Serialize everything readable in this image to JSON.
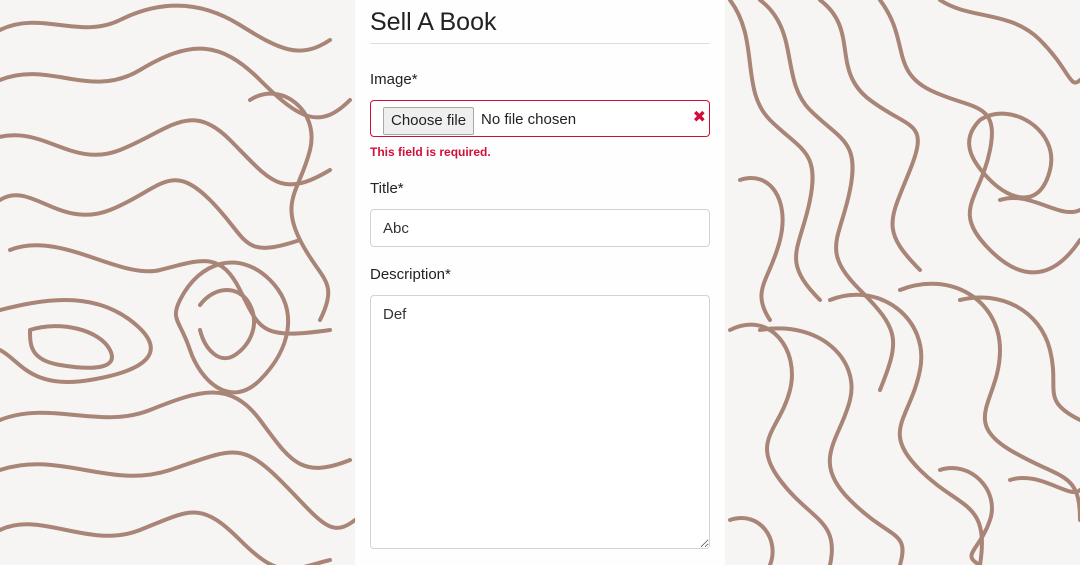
{
  "page": {
    "title": "Sell A Book"
  },
  "form": {
    "image": {
      "label": "Image*",
      "button_label": "Choose file",
      "status_text": "No file chosen",
      "clear_icon": "close-icon",
      "error": "This field is required."
    },
    "title": {
      "label": "Title*",
      "value": "Abc"
    },
    "description": {
      "label": "Description*",
      "value": "Def"
    }
  },
  "colors": {
    "error": "#d0103a",
    "background_lines": "#9b7262",
    "panel": "#ffffff"
  }
}
